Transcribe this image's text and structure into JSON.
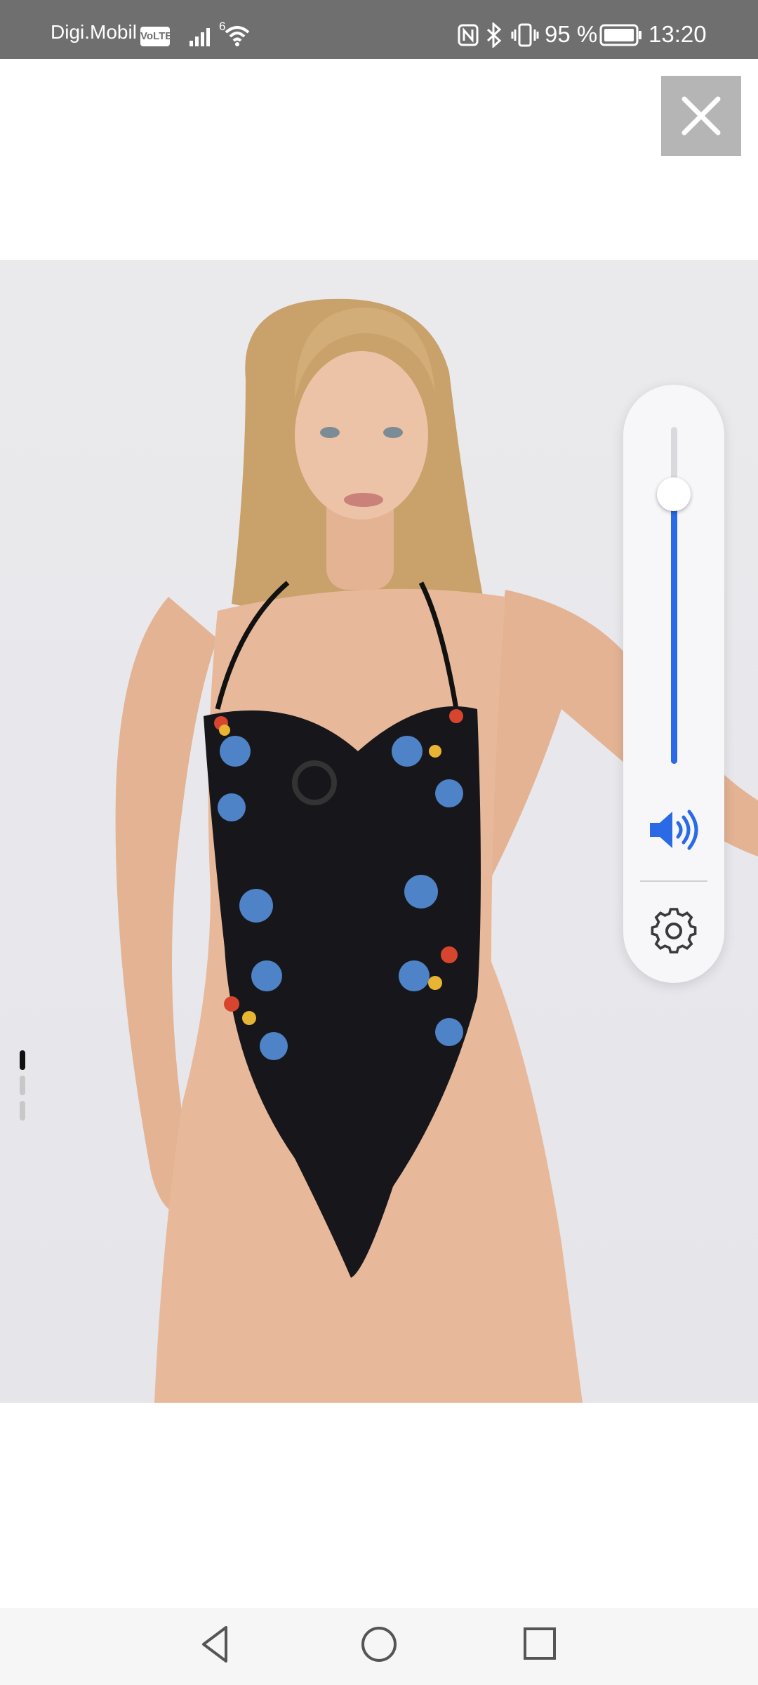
{
  "status_bar": {
    "carrier": "Digi.Mobil",
    "volte_badge": "VoLTE",
    "network_superscript": "6",
    "battery_percent": "95 %",
    "time": "13:20",
    "background_color": "#6f6f6f",
    "icons": [
      "signal-icon",
      "wifi-icon",
      "nfc-icon",
      "bluetooth-icon",
      "vibrate-icon",
      "battery-icon"
    ]
  },
  "overlay": {
    "close_icon": "close-icon"
  },
  "gallery": {
    "page_count": 3,
    "active_page": 1
  },
  "volume_panel": {
    "level_percent": 80,
    "accent_color": "#2b6ae6",
    "icons": [
      "speaker-icon",
      "gear-icon"
    ]
  },
  "nav_bar": {
    "icons": [
      "back-icon",
      "home-icon",
      "recents-icon"
    ]
  }
}
